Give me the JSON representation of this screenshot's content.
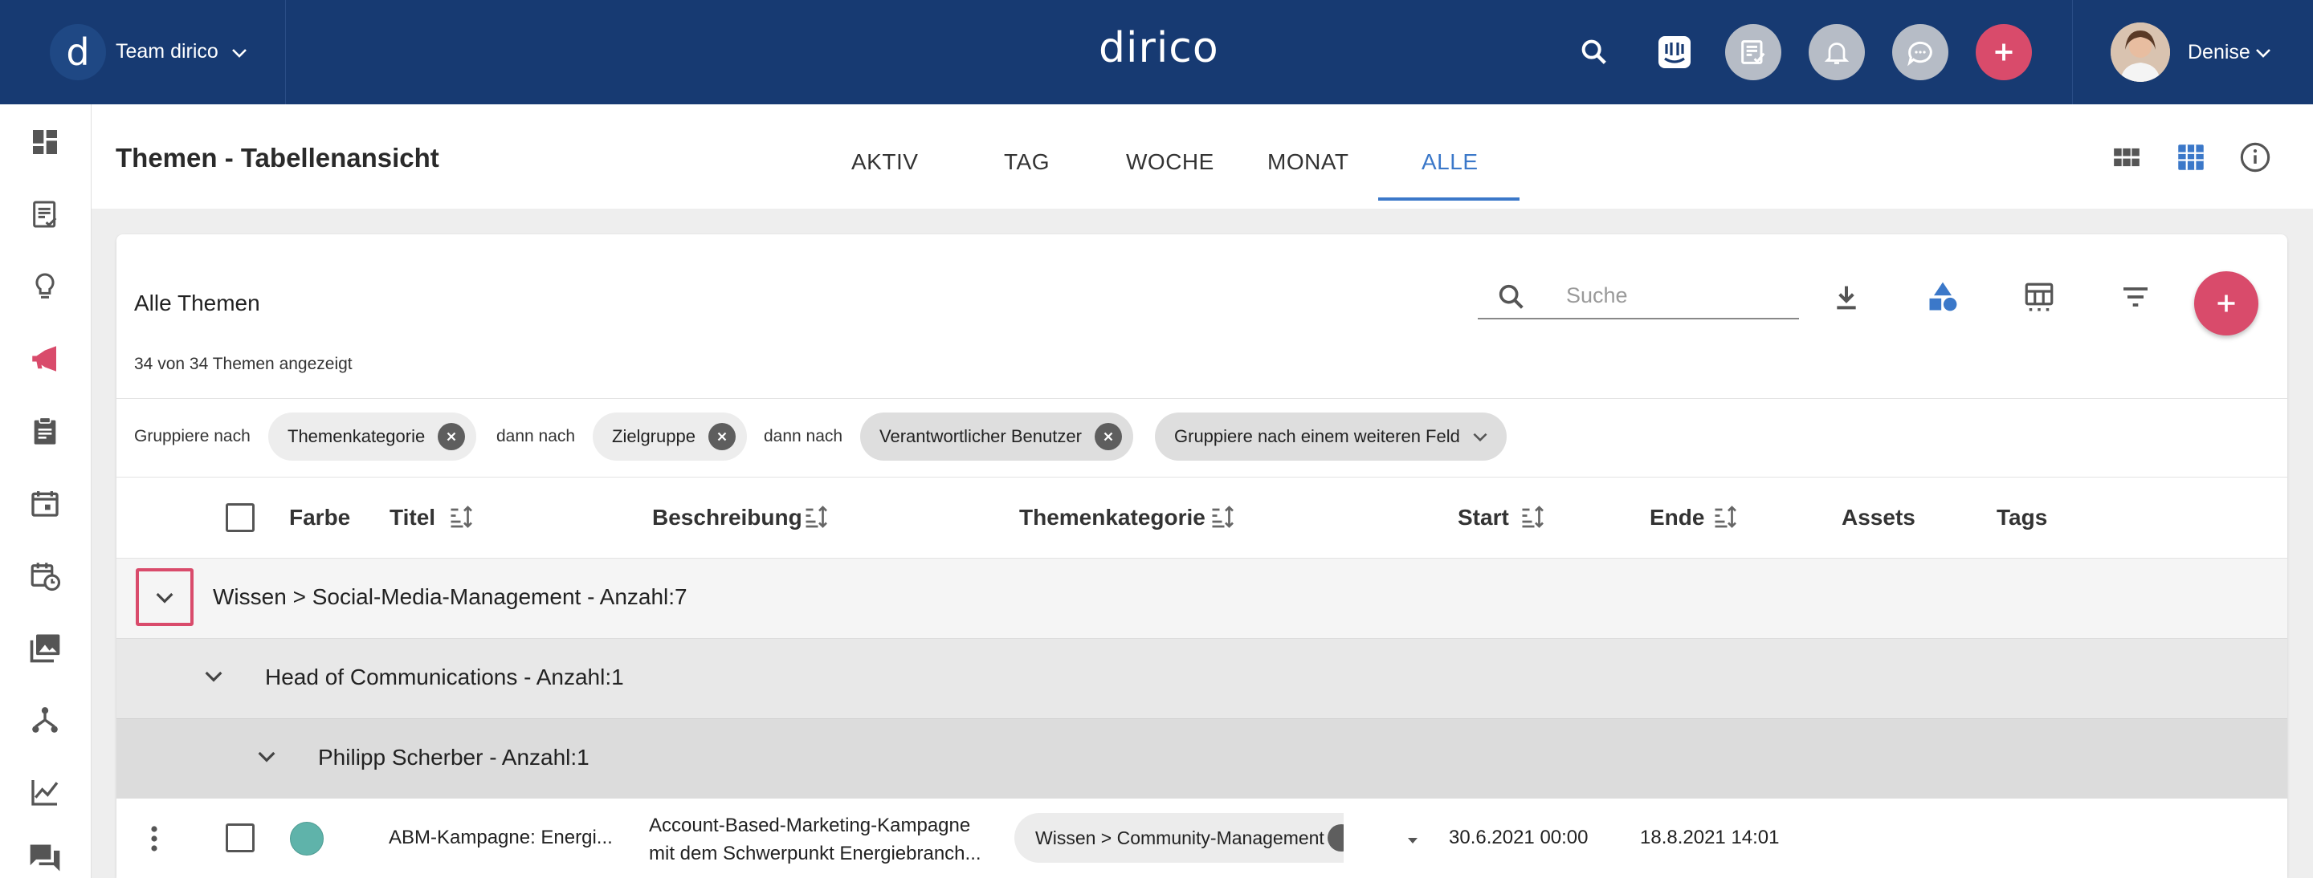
{
  "topbar": {
    "logo_letter": "d",
    "team_name": "Team dirico",
    "brand": "dirico",
    "user_name": "Denise"
  },
  "page": {
    "title": "Themen - Tabellenansicht",
    "tabs": [
      {
        "label": "AKTIV"
      },
      {
        "label": "TAG"
      },
      {
        "label": "WOCHE"
      },
      {
        "label": "MONAT"
      },
      {
        "label": "ALLE",
        "active": true
      }
    ]
  },
  "card": {
    "title": "Alle Themen",
    "count_text": "34 von 34 Themen angezeigt",
    "search_placeholder": "Suche"
  },
  "grouping": {
    "label_first": "Gruppiere nach",
    "label_then": "dann nach",
    "chips": [
      "Themenkategorie",
      "Zielgruppe",
      "Verantwortlicher Benutzer"
    ],
    "add_more": "Gruppiere nach einem weiteren Feld"
  },
  "table": {
    "columns": [
      "Farbe",
      "Titel",
      "Beschreibung",
      "Themenkategorie",
      "Start",
      "Ende",
      "Assets",
      "Tags"
    ],
    "groups": [
      {
        "level": 1,
        "text": "Wissen > Social-Media-Management  -  Anzahl:7"
      },
      {
        "level": 2,
        "text": "Head of Communications  -  Anzahl:1"
      },
      {
        "level": 3,
        "text": "Philipp Scherber  -  Anzahl:1"
      }
    ],
    "rows": [
      {
        "color": "#5fb3aa",
        "title": "ABM-Kampagne: Energi...",
        "description_line1": "Account-Based-Marketing-Kampagne",
        "description_line2": "mit dem Schwerpunkt Energiebranch...",
        "category": "Wissen > Community-Management",
        "start": "30.6.2021 00:00",
        "end": "18.8.2021 14:01"
      }
    ]
  },
  "colors": {
    "topbar": "#173a72",
    "accent_blue": "#3b78c9",
    "accent_red": "#d94b6b"
  },
  "icons": {
    "sidebar": [
      "dashboard-icon",
      "tasks-list-icon",
      "lightbulb-icon",
      "megaphone-icon",
      "clipboard-icon",
      "calendar-icon",
      "calendar-clock-icon",
      "photo-library-icon",
      "network-icon",
      "chart-line-icon",
      "chat-icon"
    ]
  }
}
